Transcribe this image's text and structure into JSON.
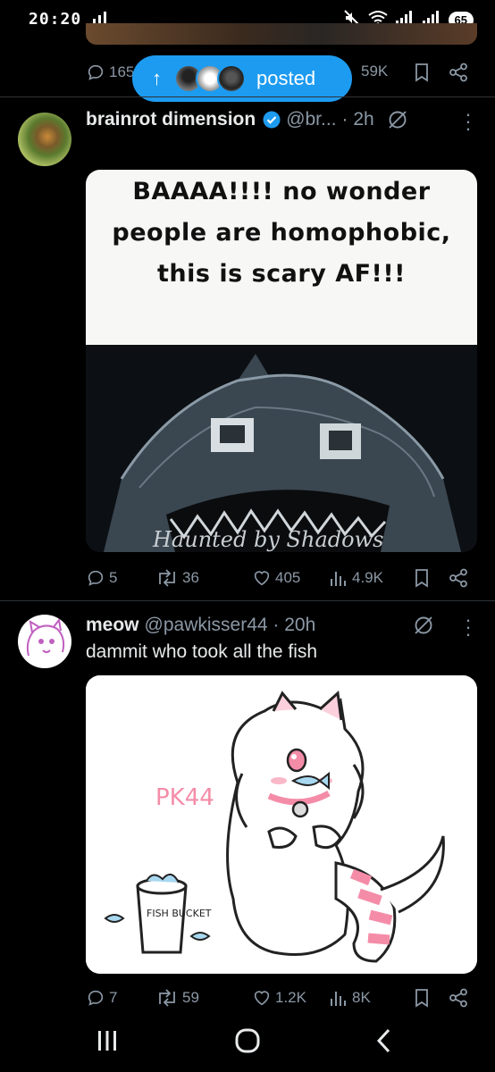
{
  "status_bar": {
    "time": "20:20",
    "battery": "65"
  },
  "top_actions": {
    "replies": "165",
    "views": "59K"
  },
  "posted_pill": {
    "label": "posted"
  },
  "tweets": [
    {
      "display_name": "brainrot dimension",
      "handle": "@br...",
      "time": "· 2h",
      "verified": true,
      "media_caption": "BAAAA!!!! no wonder people are homophobic, this is scary AF!!!",
      "watermark": "Haunted by Shadows",
      "actions": {
        "replies": "5",
        "reposts": "36",
        "likes": "405",
        "views": "4.9K"
      }
    },
    {
      "display_name": "meow",
      "handle": "@pawkisser44 · 20h",
      "text": "dammit who took all the fish",
      "media_signature": "PK44",
      "media_bucket_label": "FISH BUCKET",
      "actions": {
        "replies": "7",
        "reposts": "59",
        "likes": "1.2K",
        "views": "8K"
      }
    }
  ],
  "colors": {
    "accent": "#1d9bf0",
    "muted": "#8b98a5",
    "background": "#000000",
    "text": "#e7e9ea"
  }
}
